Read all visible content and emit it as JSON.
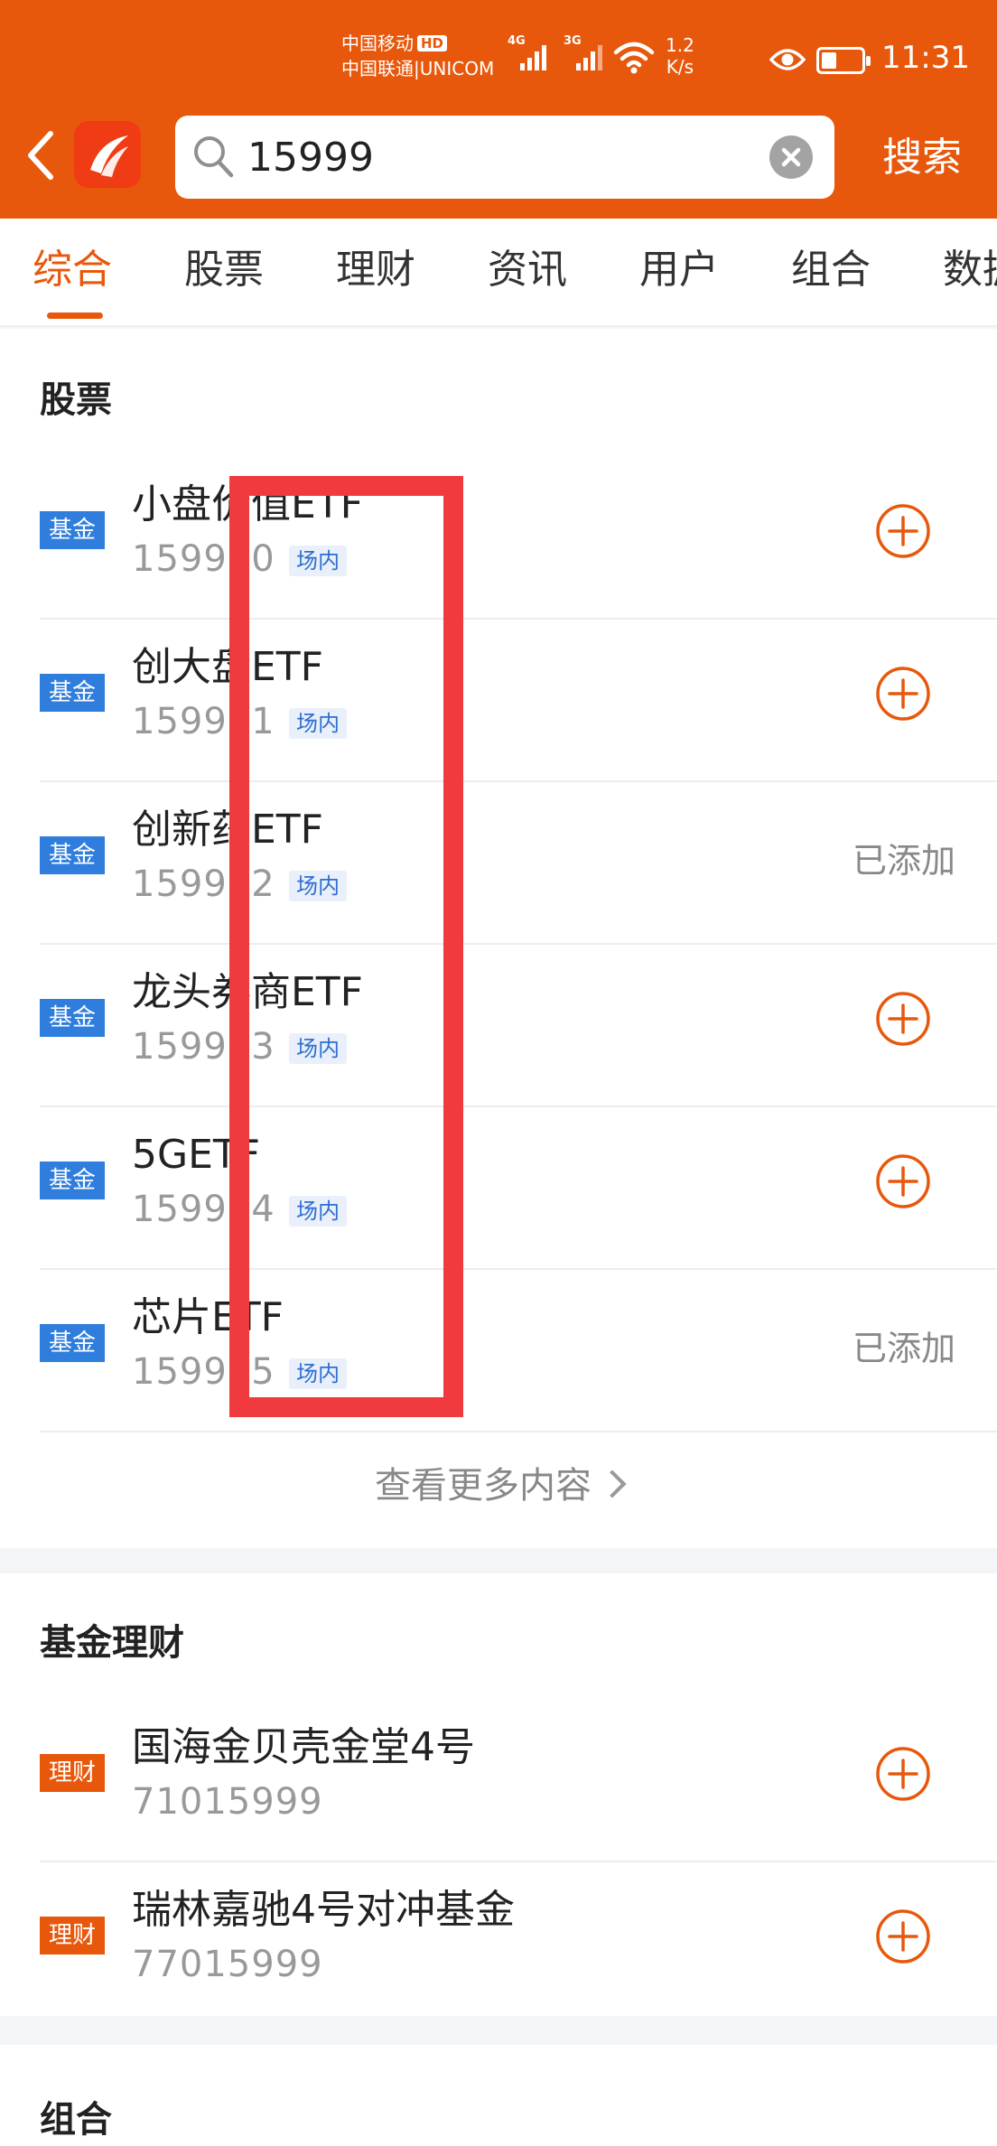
{
  "status_bar": {
    "carrier_1": "中国移动",
    "hd": "HD",
    "carrier_2": "中国联通|UNICOM",
    "net_1": "4G",
    "net_2": "3G",
    "net_speed_value": "1.2",
    "net_speed_unit": "K/s",
    "time": "11:31"
  },
  "search": {
    "query": "15999",
    "button_label": "搜索"
  },
  "tabs": [
    {
      "label": "综合",
      "active": true
    },
    {
      "label": "股票"
    },
    {
      "label": "理财"
    },
    {
      "label": "资讯"
    },
    {
      "label": "用户"
    },
    {
      "label": "组合"
    },
    {
      "label": "数据"
    }
  ],
  "stocks_section": {
    "title": "股票",
    "rows": [
      {
        "badge": "基金",
        "name": "小盘价值ETF",
        "code": "159990",
        "market": "场内",
        "status": "add"
      },
      {
        "badge": "基金",
        "name": "创大盘ETF",
        "code": "159991",
        "market": "场内",
        "status": "add"
      },
      {
        "badge": "基金",
        "name": "创新药ETF",
        "code": "159992",
        "market": "场内",
        "status": "已添加"
      },
      {
        "badge": "基金",
        "name": "龙头券商ETF",
        "code": "159993",
        "market": "场内",
        "status": "add"
      },
      {
        "badge": "基金",
        "name": "5GETF",
        "code": "159994",
        "market": "场内",
        "status": "add"
      },
      {
        "badge": "基金",
        "name": "芯片ETF",
        "code": "159995",
        "market": "场内",
        "status": "已添加"
      }
    ],
    "more_label": "查看更多内容"
  },
  "fund_section": {
    "title": "基金理财",
    "rows": [
      {
        "badge": "理财",
        "name": "国海金贝壳金堂4号",
        "code": "71015999",
        "status": "add"
      },
      {
        "badge": "理财",
        "name": "瑞林嘉驰4号对冲基金",
        "code": "77015999",
        "status": "add"
      }
    ]
  },
  "portfolio_section": {
    "title": "组合"
  },
  "colors": {
    "brand": "#e8580c",
    "fund_badge": "#2f7ddc",
    "highlight": "#f03a3e"
  }
}
